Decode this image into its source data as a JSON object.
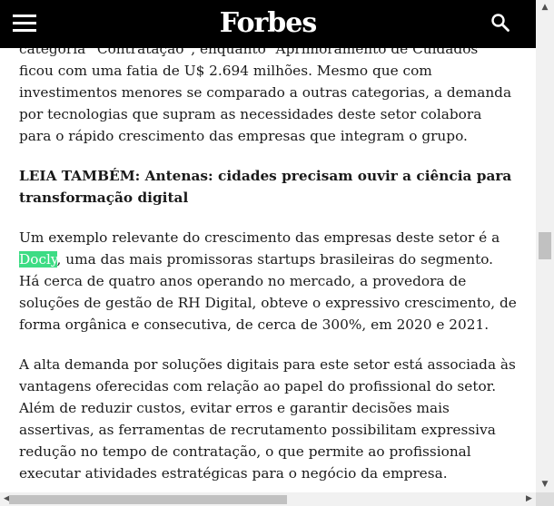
{
  "header": {
    "logo": "Forbes",
    "menu_icon": "hamburger-menu-icon",
    "search_icon": "search-icon",
    "background": "#000000"
  },
  "article": {
    "p1": "categoria “Contratação”, enquanto “Aprimoramento de Cuidados” ficou com uma fatia de U$ 2.694 milhões. Mesmo que com investimentos menores se comparado a outras categorias, a demanda por tecnologias que supram as necessidades deste setor colabora para o rápido crescimento das empresas que integram o grupo.",
    "read_also": "LEIA TAMBÉM: Antenas: cidades precisam ouvir a ciência para transformação digital",
    "p3_before": "Um exemplo relevante do crescimento das empresas deste setor é a ",
    "p3_link": "Docly",
    "p3_after": ", uma das mais promissoras startups brasileiras do segmento. Há cerca de quatro anos operando no mercado, a provedora de soluções de gestão de RH Digital, obteve o expressivo crescimento, de forma orgânica e consecutiva, de cerca de 300%, em 2020 e 2021.",
    "p4": "A alta demanda por soluções digitais para este setor está associada às vantagens oferecidas com relação ao papel do profissional do setor. Além de reduzir custos, evitar erros e garantir decisões mais assertivas, as ferramentas de recrutamento possibilitam expressiva redução no tempo de contratação, o que permite ao profissional executar atividades estratégicas para o negócio da empresa.",
    "link_highlight_color": "#3ddc84"
  },
  "scrollbars": {
    "up_arrow": "▲",
    "down_arrow": "▼",
    "left_arrow": "◀",
    "right_arrow": "▶"
  }
}
